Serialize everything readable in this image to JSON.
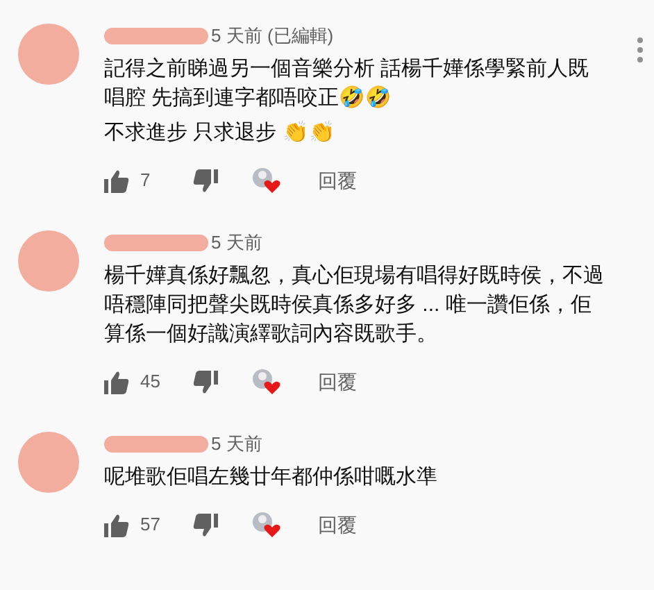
{
  "comments": [
    {
      "time": "5 天前 (已編輯)",
      "text_lines": [
        "記得之前睇過另一個音樂分析 話楊千嬅係學緊前人既唱腔 先搞到連字都唔咬正🤣🤣",
        "不求進步 只求退步 👏👏"
      ],
      "likes": "7",
      "reply": "回覆",
      "menu": true
    },
    {
      "time": "5 天前",
      "text_lines": [
        "楊千嬅真係好飄忽，真心佢現場有唱得好既時侯，不過唔穩陣同把聲尖既時侯真係多好多 ... 唯一讚佢係，佢算係一個好識演繹歌詞內容既歌手。"
      ],
      "likes": "45",
      "reply": "回覆",
      "menu": false
    },
    {
      "time": "5 天前",
      "text_lines": [
        "呢堆歌佢唱左幾廿年都仲係咁嘅水準"
      ],
      "likes": "57",
      "reply": "回覆",
      "menu": false
    }
  ]
}
